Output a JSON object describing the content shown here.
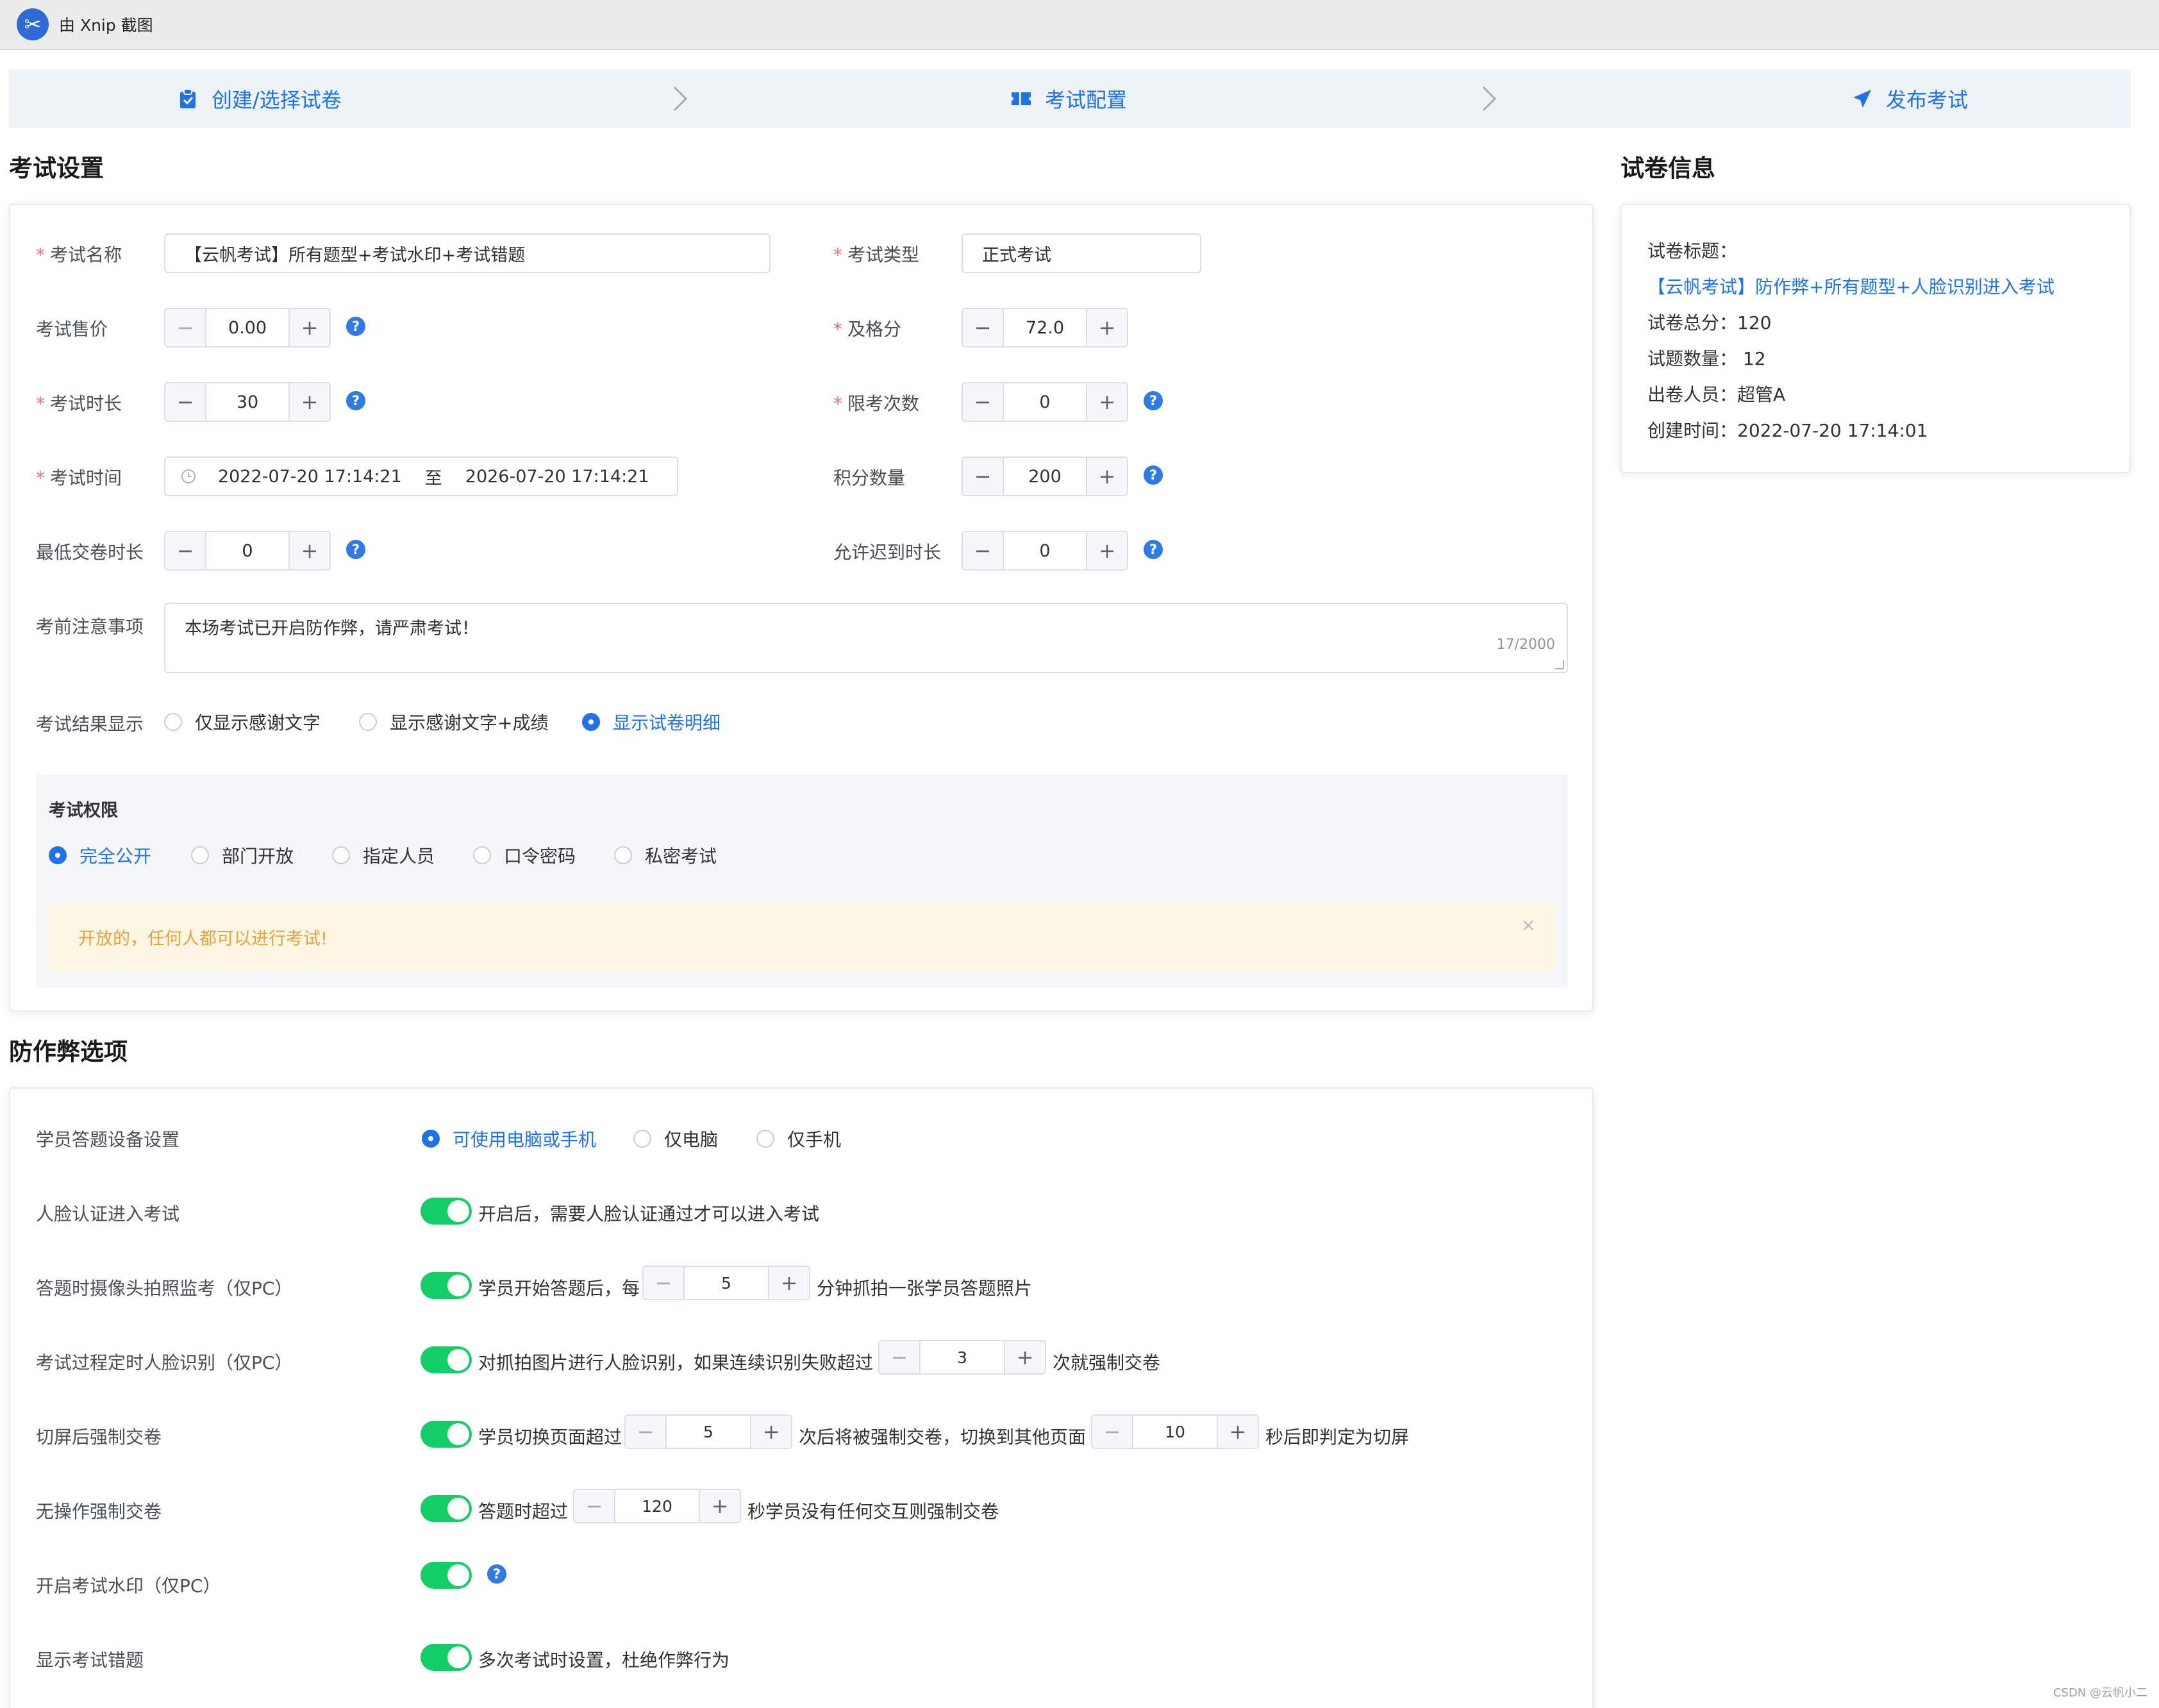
{
  "titlebar": {
    "text": "由 Xnip 截图"
  },
  "steps": [
    {
      "label": "创建/选择试卷",
      "icon": "clipboard-icon"
    },
    {
      "label": "考试配置",
      "icon": "ticket-icon"
    },
    {
      "label": "发布考试",
      "icon": "send-icon"
    }
  ],
  "settings": {
    "title": "考试设置",
    "exam_name": {
      "label": "考试名称",
      "value": "【云帆考试】所有题型+考试水印+考试错题"
    },
    "exam_type": {
      "label": "考试类型",
      "value": "正式考试"
    },
    "price": {
      "label": "考试售价",
      "value": "0.00"
    },
    "pass_score": {
      "label": "及格分",
      "value": "72.0"
    },
    "duration": {
      "label": "考试时长",
      "value": "30"
    },
    "limit_times": {
      "label": "限考次数",
      "value": "0"
    },
    "exam_time": {
      "label": "考试时间",
      "start": "2022-07-20 17:14:21",
      "sep": "至",
      "end": "2026-07-20 17:14:21"
    },
    "points": {
      "label": "积分数量",
      "value": "200"
    },
    "min_submit": {
      "label": "最低交卷时长",
      "value": "0"
    },
    "late_allow": {
      "label": "允许迟到时长",
      "value": "0"
    },
    "notice": {
      "label": "考前注意事项",
      "value": "本场考试已开启防作弊，请严肃考试！",
      "counter": "17/2000"
    },
    "result_display": {
      "label": "考试结果显示",
      "options": [
        "仅显示感谢文字",
        "显示感谢文字+成绩",
        "显示试卷明细"
      ],
      "selected": 2
    },
    "permission": {
      "title": "考试权限",
      "options": [
        "完全公开",
        "部门开放",
        "指定人员",
        "口令密码",
        "私密考试"
      ],
      "selected": 0,
      "alert": "开放的，任何人都可以进行考试!",
      "alert_close": "×"
    }
  },
  "paper_info": {
    "title": "试卷信息",
    "paper_title_label": "试卷标题：",
    "paper_title": "【云帆考试】防作弊+所有题型+人脸识别进入考试",
    "total_score": "试卷总分：120",
    "question_count": "试题数量：  12",
    "creator": "出卷人员：超管A",
    "created_at": "创建时间：2022-07-20 17:14:01"
  },
  "anticheat": {
    "title": "防作弊选项",
    "device": {
      "label": "学员答题设备设置",
      "options": [
        "可使用电脑或手机",
        "仅电脑",
        "仅手机"
      ],
      "selected": 0
    },
    "face_enter": {
      "label": "人脸认证进入考试",
      "on": true,
      "text": "开启后，需要人脸认证通过才可以进入考试"
    },
    "camera": {
      "label": "答题时摄像头拍照监考（仅PC）",
      "on": true,
      "pre": "学员开始答题后，每",
      "value": "5",
      "post": "分钟抓拍一张学员答题照片"
    },
    "face_timer": {
      "label": "考试过程定时人脸识别（仅PC）",
      "on": true,
      "pre": "对抓拍图片进行人脸识别，如果连续识别失败超过",
      "value": "3",
      "post": "次就强制交卷"
    },
    "switch_screen": {
      "label": "切屏后强制交卷",
      "on": true,
      "pre": "学员切换页面超过",
      "value1": "5",
      "mid": "次后将被强制交卷，切换到其他页面",
      "value2": "10",
      "post": "秒后即判定为切屏"
    },
    "idle": {
      "label": "无操作强制交卷",
      "on": true,
      "pre": "答题时超过",
      "value": "120",
      "post": "秒学员没有任何交互则强制交卷"
    },
    "watermark": {
      "label": "开启考试水印（仅PC）",
      "on": true
    },
    "show_wrong": {
      "label": "显示考试错题",
      "on": true,
      "text": "多次考试时设置，杜绝作弊行为"
    }
  },
  "footer_watermark": "CSDN @云帆小二",
  "colors": {
    "primary": "#1f73e6",
    "switch_on": "#13ce66",
    "required": "#f56c6c",
    "warning": "#e6a23c"
  }
}
